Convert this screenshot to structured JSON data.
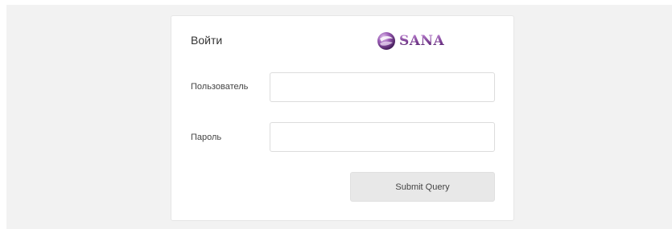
{
  "login": {
    "title": "Войти",
    "brand_name": "SANA",
    "brand_logo_icon": "sana-globe-icon",
    "username_label": "Пользователь",
    "username_value": "",
    "password_label": "Пароль",
    "password_value": "",
    "submit_label": "Submit Query"
  },
  "colors": {
    "page_background": "#f2f2f2",
    "card_background": "#ffffff",
    "brand_purple": "#8a4fa0",
    "button_background": "#e8e8e8"
  }
}
